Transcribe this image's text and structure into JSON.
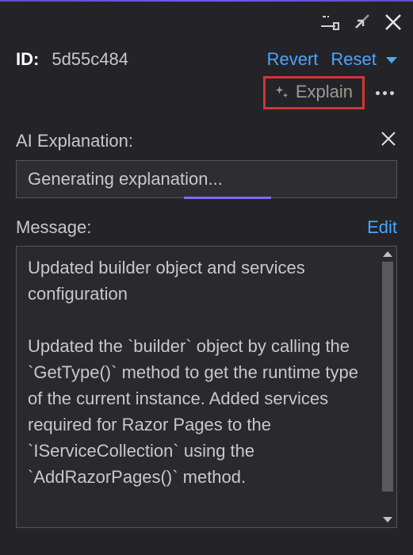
{
  "header": {
    "id_label": "ID:",
    "id_value": "5d55c484",
    "revert_label": "Revert",
    "reset_label": "Reset"
  },
  "explain": {
    "button_label": "Explain"
  },
  "ai_section": {
    "title": "AI Explanation:",
    "status_text": "Generating explanation..."
  },
  "message_section": {
    "title": "Message:",
    "edit_label": "Edit",
    "body": "Updated builder object and services configuration\n\nUpdated the `builder` object by calling the `GetType()` method to get the runtime type of the current instance. Added services required for Razor Pages to the `IServiceCollection` using the `AddRazorPages()` method."
  }
}
